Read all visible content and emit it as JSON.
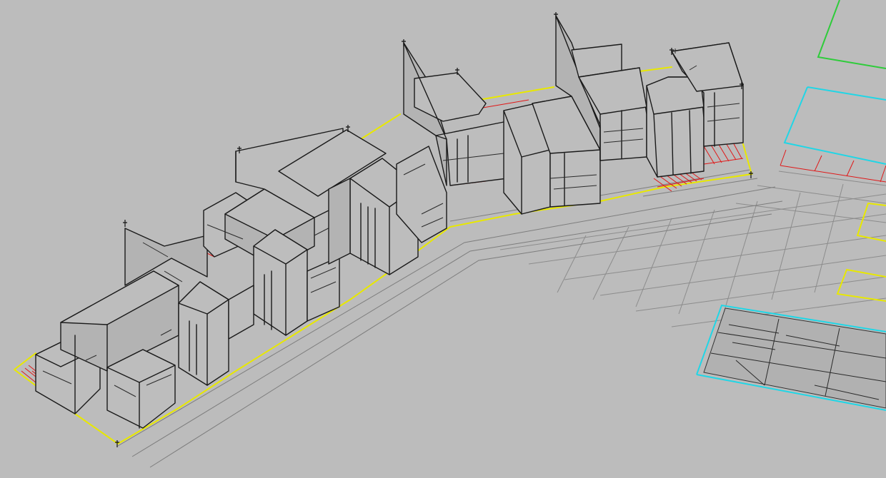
{
  "window": {
    "title": ""
  },
  "viewport": {
    "view": "isometric",
    "render_mode": "wireframe",
    "background_color": "#bcbcbc"
  },
  "colors": {
    "building_lines": "#1a1a1a",
    "property_line": "#e8e800",
    "red_hatch": "#e01818",
    "cyan_outline": "#20d6e6",
    "green_outline": "#2ecc3a",
    "grid": "#8c8c8c"
  },
  "layers": [
    {
      "name": "buildings",
      "color": "#1a1a1a"
    },
    {
      "name": "property-boundary",
      "color": "#e8e800"
    },
    {
      "name": "paving-hatch",
      "color": "#e01818"
    },
    {
      "name": "adjacent-lot",
      "color": "#20d6e6"
    },
    {
      "name": "adjacent-lot-2",
      "color": "#2ecc3a"
    }
  ]
}
